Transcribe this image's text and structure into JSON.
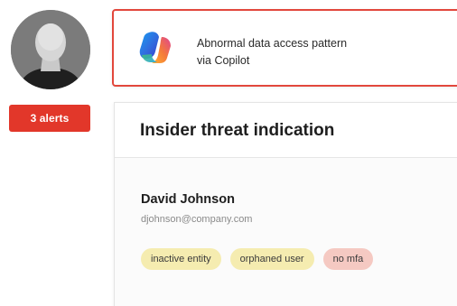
{
  "user": {
    "name": "David Johnson",
    "email": "djohnson@company.com"
  },
  "alerts": {
    "label": "3 alerts",
    "color": "#e2372a"
  },
  "alert_banner": {
    "line1": "Abnormal data access pattern",
    "line2": "via Copilot",
    "border_color": "#e2473c",
    "icon": "copilot-icon"
  },
  "card": {
    "title": "Insider threat indication"
  },
  "tags": [
    {
      "label": "inactive entity",
      "color": "#f5ecb0"
    },
    {
      "label": "orphaned user",
      "color": "#f5ecb0"
    },
    {
      "label": "no mfa",
      "color": "#f5c9c2"
    }
  ],
  "avatar": {
    "icon": "user-avatar-icon"
  }
}
